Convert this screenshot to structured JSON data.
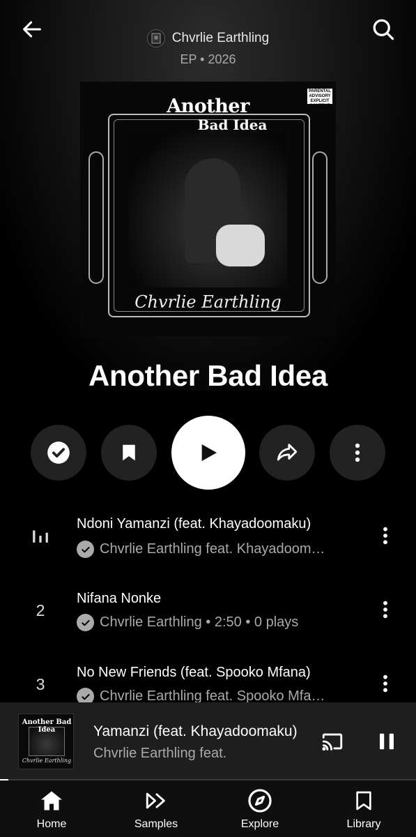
{
  "header": {
    "artist_name": "Chvrlie Earthling",
    "album_meta": "EP • 2026"
  },
  "cover": {
    "title_line1": "Another",
    "title_line2": "Bad Idea",
    "artist_script": "Chvrlie Earthling",
    "advisory_text": "PARENTAL ADVISORY EXPLICIT CONTENT"
  },
  "album": {
    "title": "Another Bad Idea"
  },
  "tracks": [
    {
      "index_indicator": "now-playing",
      "title": "Ndoni Yamanzi (feat. Khayadoomaku)",
      "subtitle": "Chvrlie Earthling feat. Khayadoom…"
    },
    {
      "number": "2",
      "title": "Nifana Nonke",
      "subtitle": "Chvrlie Earthling • 2:50 • 0 plays"
    },
    {
      "number": "3",
      "title": "No New Friends (feat. Spooko Mfana)",
      "subtitle": "Chvrlie Earthling feat. Spooko Mfa…"
    }
  ],
  "miniplayer": {
    "title": "Yamanzi (feat. Khayadoomaku)",
    "subtitle": "Chvrlie Earthling feat.",
    "cover_title": "Another Bad Idea",
    "cover_artist": "Chvrlie Earthling",
    "progress_fraction": 0.02
  },
  "nav": {
    "items": [
      {
        "label": "Home",
        "icon": "home-icon"
      },
      {
        "label": "Samples",
        "icon": "samples-icon"
      },
      {
        "label": "Explore",
        "icon": "explore-icon"
      },
      {
        "label": "Library",
        "icon": "library-icon"
      }
    ]
  },
  "colors": {
    "background": "#000000",
    "surface": "#222222",
    "miniplayer_bg": "#1e1e1e",
    "text_primary": "#ffffff",
    "text_secondary": "#aaaaaa"
  }
}
